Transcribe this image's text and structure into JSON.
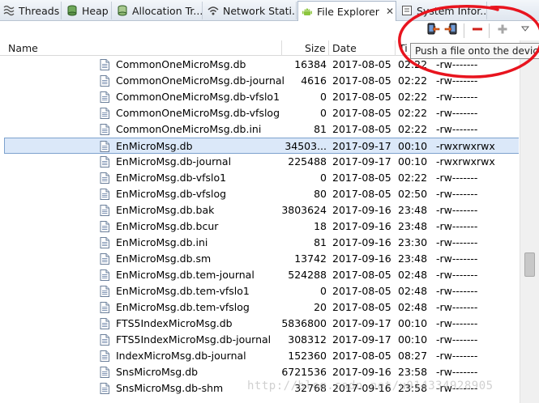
{
  "tabs": [
    {
      "label": "Threads",
      "icon": "threads-icon"
    },
    {
      "label": "Heap",
      "icon": "heap-icon"
    },
    {
      "label": "Allocation Tr...",
      "icon": "allocation-icon"
    },
    {
      "label": "Network Stati...",
      "icon": "network-icon"
    },
    {
      "label": "File Explorer",
      "icon": "android-icon",
      "active": true,
      "close": "✕"
    },
    {
      "label": "System Infor...",
      "icon": "system-info-icon"
    }
  ],
  "toolbar": {
    "pull_icon": "pull-file-icon",
    "push_icon": "push-file-icon",
    "delete_icon": "delete-icon",
    "new_folder_icon": "add-icon",
    "menu_icon": "view-menu-icon"
  },
  "tooltip": "Push a file onto the device",
  "columns": {
    "name": "Name",
    "size": "Size",
    "date": "Date",
    "time": "Ti",
    "permissions": ""
  },
  "files": [
    {
      "name": "CommonOneMicroMsg.db",
      "size": "16384",
      "date": "2017-08-05",
      "time": "02:22",
      "perm": "-rw-------"
    },
    {
      "name": "CommonOneMicroMsg.db-journal",
      "size": "4616",
      "date": "2017-08-05",
      "time": "02:22",
      "perm": "-rw-------"
    },
    {
      "name": "CommonOneMicroMsg.db-vfslo1",
      "size": "0",
      "date": "2017-08-05",
      "time": "02:22",
      "perm": "-rw-------"
    },
    {
      "name": "CommonOneMicroMsg.db-vfslog",
      "size": "0",
      "date": "2017-08-05",
      "time": "02:22",
      "perm": "-rw-------"
    },
    {
      "name": "CommonOneMicroMsg.db.ini",
      "size": "81",
      "date": "2017-08-05",
      "time": "02:22",
      "perm": "-rw-------"
    },
    {
      "name": "EnMicroMsg.db",
      "size": "34503...",
      "date": "2017-09-17",
      "time": "00:10",
      "perm": "-rwxrwxrwx",
      "selected": true
    },
    {
      "name": "EnMicroMsg.db-journal",
      "size": "225488",
      "date": "2017-09-17",
      "time": "00:10",
      "perm": "-rwxrwxrwx"
    },
    {
      "name": "EnMicroMsg.db-vfslo1",
      "size": "0",
      "date": "2017-08-05",
      "time": "02:22",
      "perm": "-rw-------"
    },
    {
      "name": "EnMicroMsg.db-vfslog",
      "size": "80",
      "date": "2017-08-05",
      "time": "02:50",
      "perm": "-rw-------"
    },
    {
      "name": "EnMicroMsg.db.bak",
      "size": "3803624",
      "date": "2017-09-16",
      "time": "23:48",
      "perm": "-rw-------"
    },
    {
      "name": "EnMicroMsg.db.bcur",
      "size": "18",
      "date": "2017-09-16",
      "time": "23:48",
      "perm": "-rw-------"
    },
    {
      "name": "EnMicroMsg.db.ini",
      "size": "81",
      "date": "2017-09-16",
      "time": "23:30",
      "perm": "-rw-------"
    },
    {
      "name": "EnMicroMsg.db.sm",
      "size": "13742",
      "date": "2017-09-16",
      "time": "23:48",
      "perm": "-rw-------"
    },
    {
      "name": "EnMicroMsg.db.tem-journal",
      "size": "524288",
      "date": "2017-08-05",
      "time": "02:48",
      "perm": "-rw-------"
    },
    {
      "name": "EnMicroMsg.db.tem-vfslo1",
      "size": "0",
      "date": "2017-08-05",
      "time": "02:48",
      "perm": "-rw-------"
    },
    {
      "name": "EnMicroMsg.db.tem-vfslog",
      "size": "20",
      "date": "2017-08-05",
      "time": "02:48",
      "perm": "-rw-------"
    },
    {
      "name": "FTS5IndexMicroMsg.db",
      "size": "5836800",
      "date": "2017-09-17",
      "time": "00:10",
      "perm": "-rw-------"
    },
    {
      "name": "FTS5IndexMicroMsg.db-journal",
      "size": "308312",
      "date": "2017-09-17",
      "time": "00:10",
      "perm": "-rw-------"
    },
    {
      "name": "IndexMicroMsg.db-journal",
      "size": "152360",
      "date": "2017-08-05",
      "time": "08:27",
      "perm": "-rw-------"
    },
    {
      "name": "SnsMicroMsg.db",
      "size": "6721536",
      "date": "2017-09-16",
      "time": "23:58",
      "perm": "-rw-------"
    },
    {
      "name": "SnsMicroMsg.db-shm",
      "size": "32768",
      "date": "2017-09-16",
      "time": "23:58",
      "perm": "-rw-------"
    }
  ],
  "watermark": "http://blog.csdn.net/u014334928905",
  "colors": {
    "selection": "#dbe8f9",
    "annotation": "#e8141e",
    "delete": "#d0201a"
  }
}
